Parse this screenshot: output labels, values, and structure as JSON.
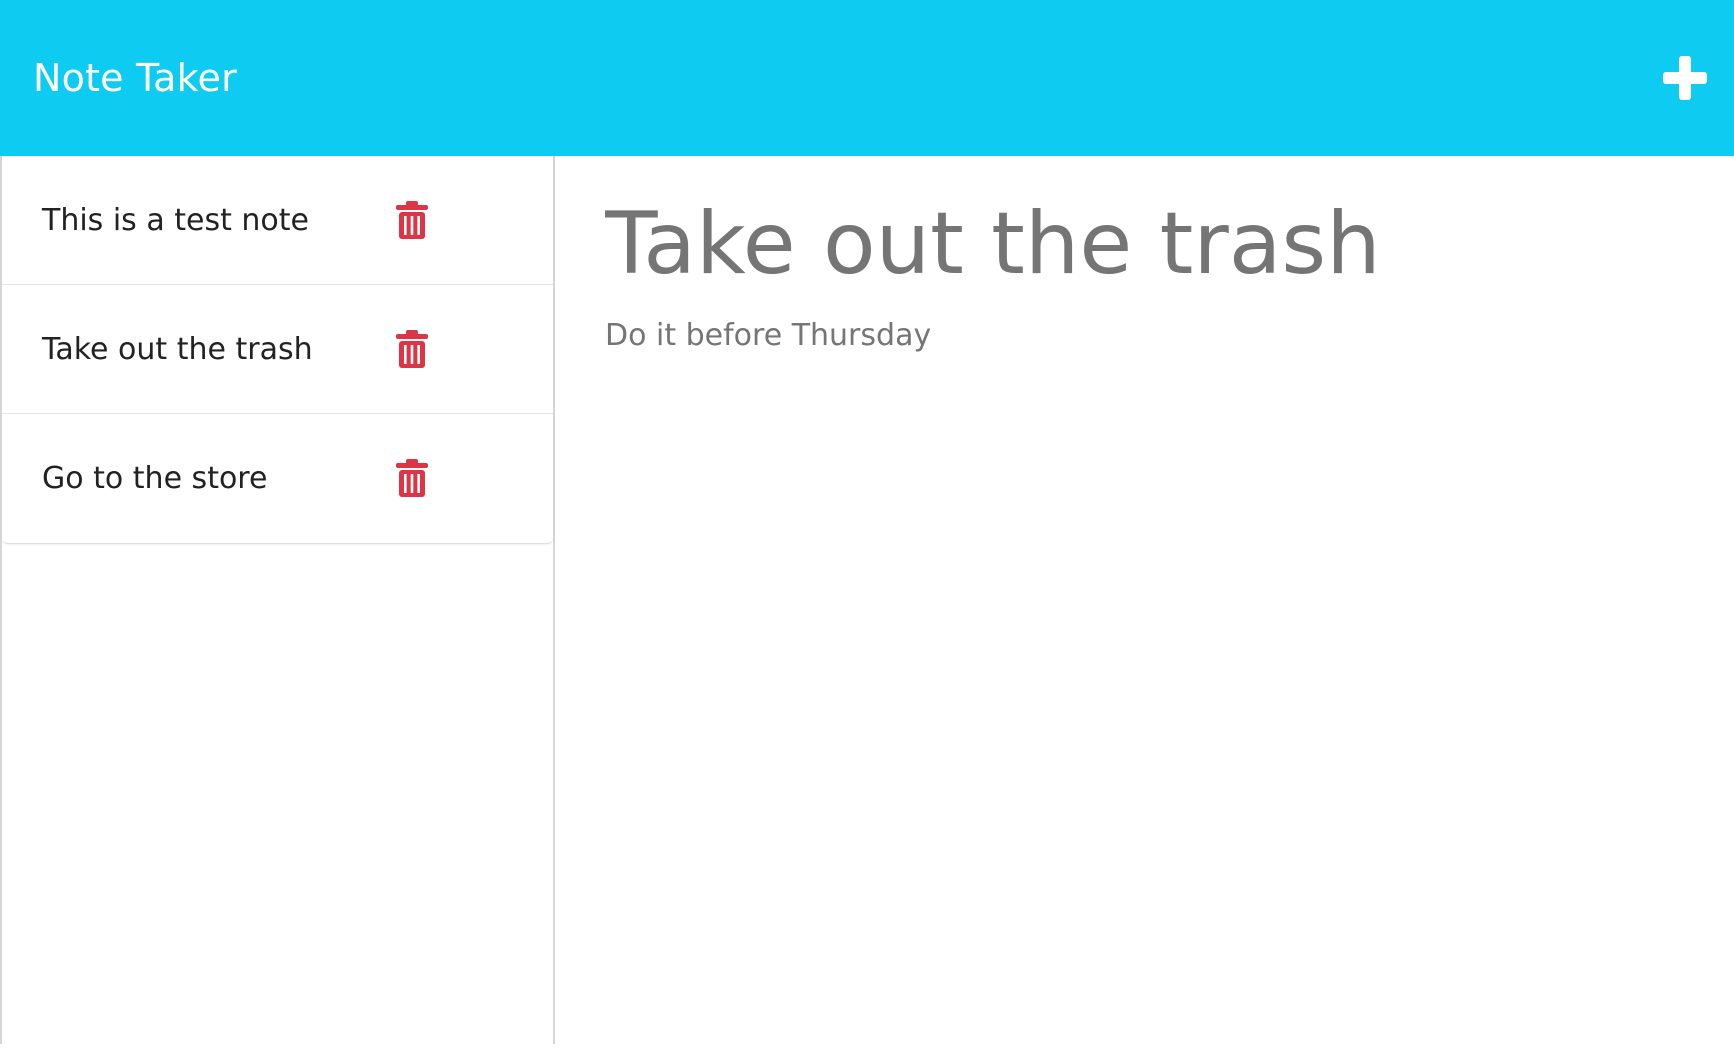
{
  "app": {
    "title": "Note Taker",
    "accent_color": "#0ecbf1",
    "delete_color": "#dc3545"
  },
  "navbar": {
    "title": "Note Taker",
    "new_note_icon": "plus-icon"
  },
  "notes": [
    {
      "title": "This is a test note",
      "icon": "trash-icon"
    },
    {
      "title": "Take out the trash",
      "icon": "trash-icon"
    },
    {
      "title": "Go to the store",
      "icon": "trash-icon"
    }
  ],
  "editor": {
    "title_value": "Take out the trash",
    "text_value": "Do it before Thursday"
  }
}
